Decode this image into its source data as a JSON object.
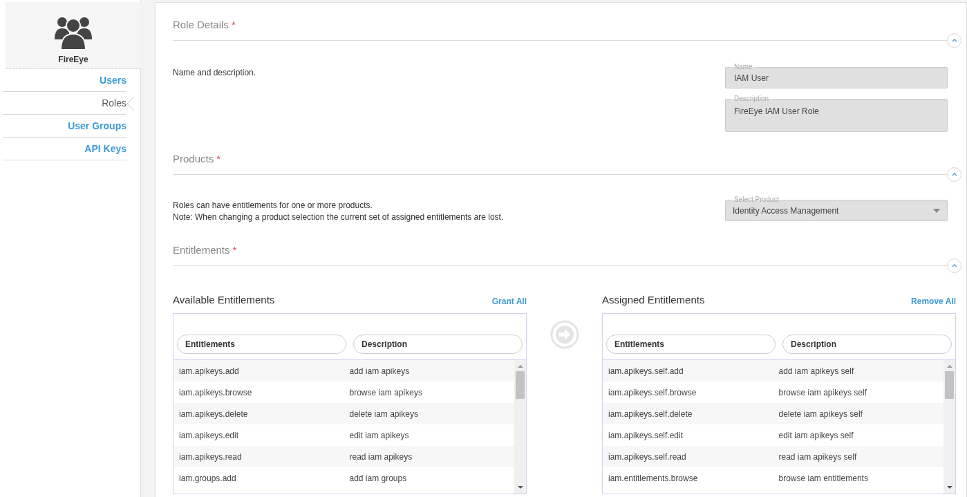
{
  "sidebar": {
    "logo_label": "FireEye",
    "items": [
      {
        "label": "Users",
        "selected": false
      },
      {
        "label": "Roles",
        "selected": true
      },
      {
        "label": "User Groups",
        "selected": false
      },
      {
        "label": "API Keys",
        "selected": false
      }
    ]
  },
  "role_details": {
    "title": "Role Details",
    "required_mark": "*",
    "expanded": true,
    "hint": "Name and description.",
    "name_field": {
      "label": "Name",
      "value": "IAM User"
    },
    "description_field": {
      "label": "Description",
      "value": "FireEye IAM User Role"
    }
  },
  "products": {
    "title": "Products",
    "required_mark": "*",
    "expanded": true,
    "hint_lines": [
      "Roles can have entitlements for one or more products.",
      "Note: When changing a product selection the current set of assigned entitlements are lost."
    ],
    "select": {
      "label": "Select Product",
      "value": "Identity Access Management"
    }
  },
  "entitlements": {
    "title": "Entitlements",
    "required_mark": "*",
    "expanded": true,
    "lists": [
      {
        "title": "Available Entitlements",
        "action": "Grant All",
        "columns": [
          "Entitlements",
          "Description"
        ],
        "rows": [
          [
            "iam.apikeys.add",
            "add iam apikeys"
          ],
          [
            "iam.apikeys.browse",
            "browse iam apikeys"
          ],
          [
            "iam.apikeys.delete",
            "delete iam apikeys"
          ],
          [
            "iam.apikeys.edit",
            "edit iam apikeys"
          ],
          [
            "iam.apikeys.read",
            "read iam apikeys"
          ],
          [
            "iam.groups.add",
            "add iam groups"
          ]
        ]
      },
      {
        "title": "Assigned Entitlements",
        "action": "Remove All",
        "columns": [
          "Entitlements",
          "Description"
        ],
        "rows": [
          [
            "iam.apikeys.self.add",
            "add iam apikeys self"
          ],
          [
            "iam.apikeys.self.browse",
            "browse iam apikeys self"
          ],
          [
            "iam.apikeys.self.delete",
            "delete iam apikeys self"
          ],
          [
            "iam.apikeys.self.edit",
            "edit iam apikeys self"
          ],
          [
            "iam.apikeys.self.read",
            "read iam apikeys self"
          ],
          [
            "iam.entitlements.browse",
            "browse iam entitlements"
          ]
        ]
      }
    ]
  }
}
